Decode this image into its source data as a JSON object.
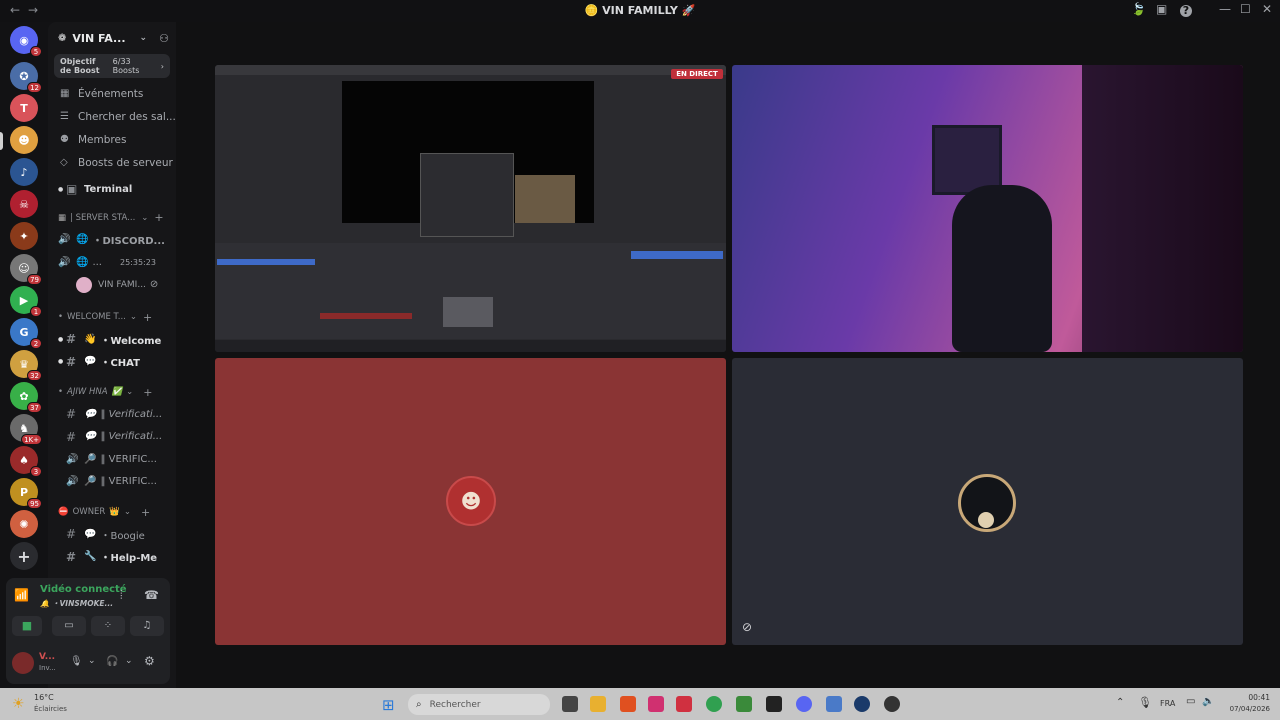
{
  "window": {
    "title": "VIN FAMILLY",
    "back": "←",
    "forward": "→",
    "minimize": "—",
    "maximize": "☐",
    "close": "✕"
  },
  "guilds": [
    {
      "badge": "5",
      "color": "#5865f2"
    },
    {
      "badge": "12",
      "color": "#4a6da7"
    },
    {
      "badge": "",
      "color": "#d9535a"
    },
    {
      "badge": "",
      "color": "#e0a040"
    },
    {
      "badge": "",
      "color": "#2b5592"
    },
    {
      "badge": "",
      "color": "#b02030"
    },
    {
      "badge": "",
      "color": "#8a3a1a"
    },
    {
      "badge": "79",
      "color": "#777777"
    },
    {
      "badge": "1",
      "color": "#30b050"
    },
    {
      "badge": "2",
      "color": "#3a78c8"
    },
    {
      "badge": "32",
      "color": "#d0a040"
    },
    {
      "badge": "37",
      "color": "#38b048"
    },
    {
      "badge": "1K+",
      "color": "#6a6a6a"
    },
    {
      "badge": "3",
      "color": "#9a2a2a"
    },
    {
      "badge": "95",
      "color": "#c09020"
    },
    {
      "badge": "",
      "color": "#d06040"
    }
  ],
  "server": {
    "name": "VIN FA...",
    "boost_goal": "Objectif de Boost",
    "boost_count": "6/33 Boosts",
    "menu": [
      {
        "icon": "calendar-icon",
        "label": "Événements"
      },
      {
        "icon": "search-channels-icon",
        "label": "Chercher des sal..."
      },
      {
        "icon": "members-icon",
        "label": "Membres"
      },
      {
        "icon": "boost-icon",
        "label": "Boosts de serveur"
      }
    ],
    "terminal": "Terminal",
    "categories": {
      "server_stats": "| SERVER STA...",
      "welcome": "WELCOME T...",
      "ajiw": "AJIW HNA",
      "owner": "OWNER"
    },
    "stats_channels": [
      {
        "label": "・DISCORD..."
      },
      {
        "label": "...",
        "time": "25:35:23"
      }
    ],
    "voice_user": "VIN FAMI...",
    "welcome_channels": [
      "・Welcome",
      "・CHAT"
    ],
    "ajiw_channels": [
      "‖ Verificati...",
      "‖ Verificati...",
      "‖ VERIFIC...",
      "‖ VERIFIC..."
    ],
    "owner_channels": [
      "・Boogie",
      "・Help-Me"
    ]
  },
  "voice_panel": {
    "status": "Vidéo connecté",
    "channel": "VINSMOKE...",
    "user_name": "V...",
    "user_status": "Inv..."
  },
  "stage": {
    "live_badge": "EN DIRECT",
    "tile_colors": {
      "obs_bg": "#3c3c42",
      "room_bg": "#5a3a8a",
      "red_tile": "#8a3434",
      "dark_tile": "#2a2c35"
    }
  },
  "taskbar": {
    "weather_temp": "16°C",
    "weather_desc": "Éclaircies",
    "search_placeholder": "Rechercher",
    "lang": "FRA",
    "time": "00:41",
    "date": "07/04/2026"
  }
}
